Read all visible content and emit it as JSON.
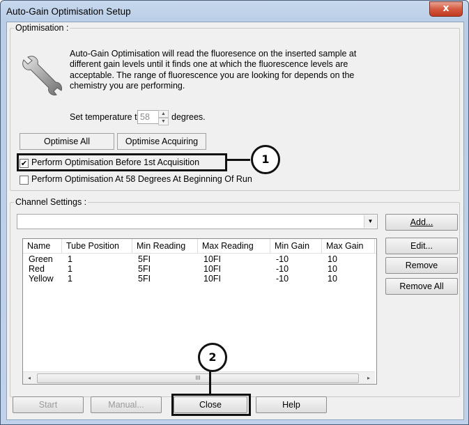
{
  "window": {
    "title": "Auto-Gain Optimisation Setup",
    "close_glyph": "x"
  },
  "optimisation": {
    "legend": "Optimisation :",
    "description_lines": [
      "Auto-Gain Optimisation will read the fluoresence on the inserted sample at",
      "different gain levels until it finds one at which the fluorescence levels are",
      "acceptable. The range of fluorescence you are looking for depends on the",
      "chemistry you are performing."
    ],
    "temp_prefix": "Set temperature to",
    "temp_value": "58",
    "temp_suffix": "degrees.",
    "optimise_all": "Optimise All",
    "optimise_acquiring": "Optimise Acquiring",
    "check_before_first": {
      "label": "Perform Optimisation Before 1st Acquisition",
      "checked": true,
      "glyph": "✔"
    },
    "check_at_58": {
      "label": "Perform Optimisation At 58 Degrees At Beginning Of Run",
      "checked": false
    }
  },
  "channel_settings": {
    "legend": "Channel Settings :",
    "combo_value": "",
    "columns": [
      "Name",
      "Tube Position",
      "Min Reading",
      "Max Reading",
      "Min Gain",
      "Max Gain"
    ],
    "rows": [
      [
        "Green",
        "1",
        "5FI",
        "10FI",
        "-10",
        "10"
      ],
      [
        "Red",
        "1",
        "5FI",
        "10FI",
        "-10",
        "10"
      ],
      [
        "Yellow",
        "1",
        "5FI",
        "10FI",
        "-10",
        "10"
      ]
    ],
    "buttons": {
      "add": "Add...",
      "edit": "Edit...",
      "remove": "Remove",
      "remove_all": "Remove All"
    },
    "scroll_left": "◂",
    "scroll_right": "▸",
    "scroll_grip": "III"
  },
  "bottom_buttons": {
    "start": "Start",
    "manual": "Manual...",
    "close": "Close",
    "help": "Help"
  },
  "callouts": {
    "one": "1",
    "two": "2"
  },
  "icons": {
    "wrench": "wrench-icon",
    "dropdown": "chevron-down-icon"
  },
  "colors": {
    "title_bar": "#c8d9ee",
    "close_button": "#c23a1f",
    "client_bg": "#f0f0f0"
  }
}
